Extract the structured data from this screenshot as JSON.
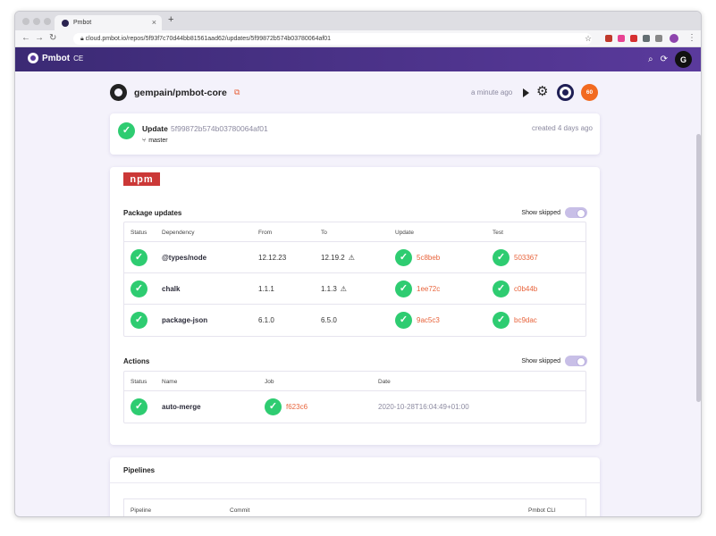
{
  "browser": {
    "tab_title": "Pmbot",
    "tab_close": "×",
    "new_tab": "+",
    "url": "cloud.pmbot.io/repos/5f93f7c70d44bb81561aad62/updates/5f99872b574b03780064af01"
  },
  "app": {
    "brand": "Pmbot",
    "edition": "CE",
    "avatar_letter": "G"
  },
  "repo": {
    "name": "gempain/pmbot-core",
    "last_run": "a minute ago",
    "score": "60"
  },
  "update": {
    "title": "Update",
    "hash": "5f99872b574b03780064af01",
    "created": "created 4 days ago",
    "branch": "master"
  },
  "npm": {
    "logo": "npm",
    "package_updates": {
      "title": "Package updates",
      "show_skipped": "Show skipped",
      "columns": [
        "Status",
        "Dependency",
        "From",
        "To",
        "Update",
        "Test"
      ],
      "rows": [
        {
          "dependency": "@types/node",
          "from": "12.12.23",
          "to": "12.19.2",
          "update": "5c8beb",
          "test": "503367"
        },
        {
          "dependency": "chalk",
          "from": "1.1.1",
          "to": "1.1.3",
          "update": "1ee72c",
          "test": "c0b44b"
        },
        {
          "dependency": "package-json",
          "from": "6.1.0",
          "to": "6.5.0",
          "update": "9ac5c3",
          "test": "bc9dac"
        }
      ]
    },
    "actions": {
      "title": "Actions",
      "show_skipped": "Show skipped",
      "columns": [
        "Status",
        "Name",
        "Job",
        "Date"
      ],
      "rows": [
        {
          "name": "auto-merge",
          "job": "f623c6",
          "date": "2020-10-28T16:04:49+01:00"
        }
      ]
    }
  },
  "pipelines": {
    "title": "Pipelines",
    "columns": [
      "Pipeline",
      "Commit",
      "Pmbot CLI"
    ]
  },
  "colors": {
    "brand": "#4a3288",
    "success": "#2ecc71",
    "link": "#e8643c",
    "npm": "#cb3837"
  }
}
